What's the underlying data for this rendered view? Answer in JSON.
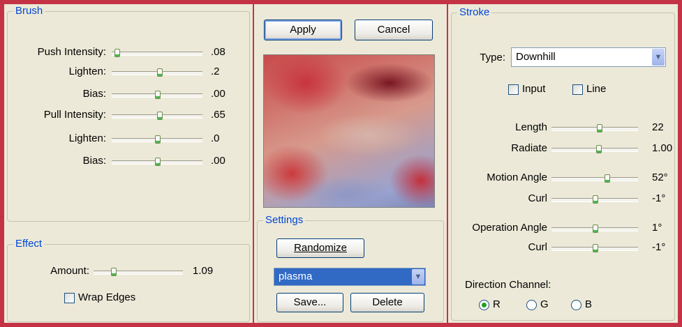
{
  "brush": {
    "title": "Brush",
    "sliders": [
      {
        "label": "Push Intensity:",
        "value": ".08",
        "pos": 0.05
      },
      {
        "label": "Lighten:",
        "value": ".2",
        "pos": 0.52
      },
      {
        "label": "Bias:",
        "value": ".00",
        "pos": 0.5
      },
      {
        "label": "Pull Intensity:",
        "value": ".65",
        "pos": 0.52
      },
      {
        "label": "Lighten:",
        "value": ".0",
        "pos": 0.5
      },
      {
        "label": "Bias:",
        "value": ".00",
        "pos": 0.5
      }
    ]
  },
  "effect": {
    "title": "Effect",
    "amount_label": "Amount:",
    "amount_value": "1.09",
    "amount_pos": 0.22,
    "wrap_edges_label": "Wrap Edges",
    "wrap_edges_checked": false
  },
  "buttons": {
    "apply": "Apply",
    "cancel": "Cancel"
  },
  "settings": {
    "title": "Settings",
    "randomize": "Randomize",
    "preset_value": "plasma",
    "save": "Save...",
    "delete": "Delete"
  },
  "stroke": {
    "title": "Stroke",
    "type_label": "Type:",
    "type_value": "Downhill",
    "input_label": "Input",
    "line_label": "Line",
    "sliders": [
      {
        "label": "Length",
        "value": "22",
        "pos": 0.55
      },
      {
        "label": "Radiate",
        "value": "1.00",
        "pos": 0.54
      },
      {
        "label": "Motion Angle",
        "value": "52°",
        "pos": 0.64
      },
      {
        "label": "Curl",
        "value": "-1°",
        "pos": 0.5
      },
      {
        "label": "Operation Angle",
        "value": "1°",
        "pos": 0.5
      },
      {
        "label": "Curl",
        "value": "-1°",
        "pos": 0.5
      }
    ],
    "direction_label": "Direction Channel:",
    "channels": [
      {
        "label": "R",
        "selected": true
      },
      {
        "label": "G",
        "selected": false
      },
      {
        "label": "B",
        "selected": false
      }
    ]
  }
}
